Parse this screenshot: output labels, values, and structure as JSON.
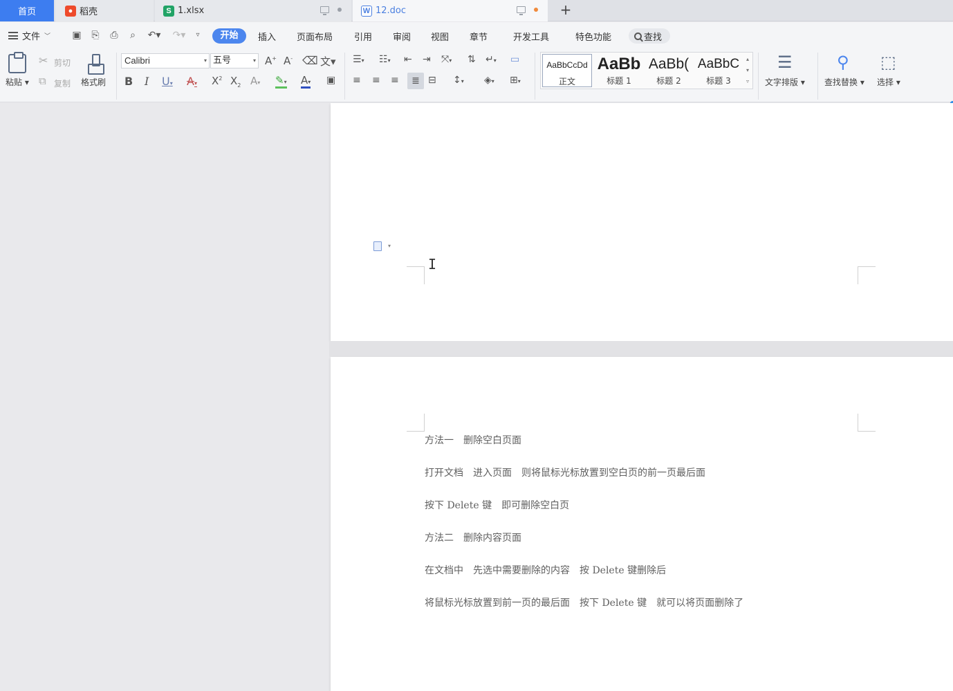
{
  "tabs": {
    "home": "首页",
    "daoke": "稻壳",
    "xlsx": "1.xlsx",
    "doc": "12.doc",
    "add": "+"
  },
  "menu": {
    "file": "文件",
    "items": [
      "开始",
      "插入",
      "页面布局",
      "引用",
      "审阅",
      "视图",
      "章节",
      "开发工具",
      "特色功能"
    ],
    "search": "查找"
  },
  "ribbon": {
    "paste": "粘贴",
    "cut": "剪切",
    "copy": "复制",
    "format_painter": "格式刷",
    "font_name": "Calibri",
    "font_size": "五号",
    "styles": {
      "normal_preview": "AaBbCcDd",
      "normal": "正文",
      "h1_preview": "AaBb",
      "h1": "标题 1",
      "h2_preview": "AaBb(",
      "h2": "标题 2",
      "h3_preview": "AaBbC",
      "h3": "标题 3"
    },
    "text_layout": "文字排版",
    "find_replace": "查找替换",
    "select": "选择"
  },
  "document": {
    "lines": [
      "方法一　删除空白页面",
      "打开文档　进入页面　则将鼠标光标放置到空白页的前一页最后面",
      "按下 Delete 键　即可删除空白页",
      "方法二　删除内容页面",
      "在文档中　先选中需要删除的内容　按 Delete 键删除后",
      "将鼠标光标放置到前一页的最后面　按下 Delete 键　就可以将页面删除了"
    ]
  },
  "colors": {
    "accent": "#4c86ee",
    "home_tab": "#3d7df0",
    "doc_tab_text": "#4a7fe0",
    "xlsx_icon": "#21a366",
    "daoke_icon": "#ee4a2b",
    "unsaved_dot": "#f08a3c"
  }
}
